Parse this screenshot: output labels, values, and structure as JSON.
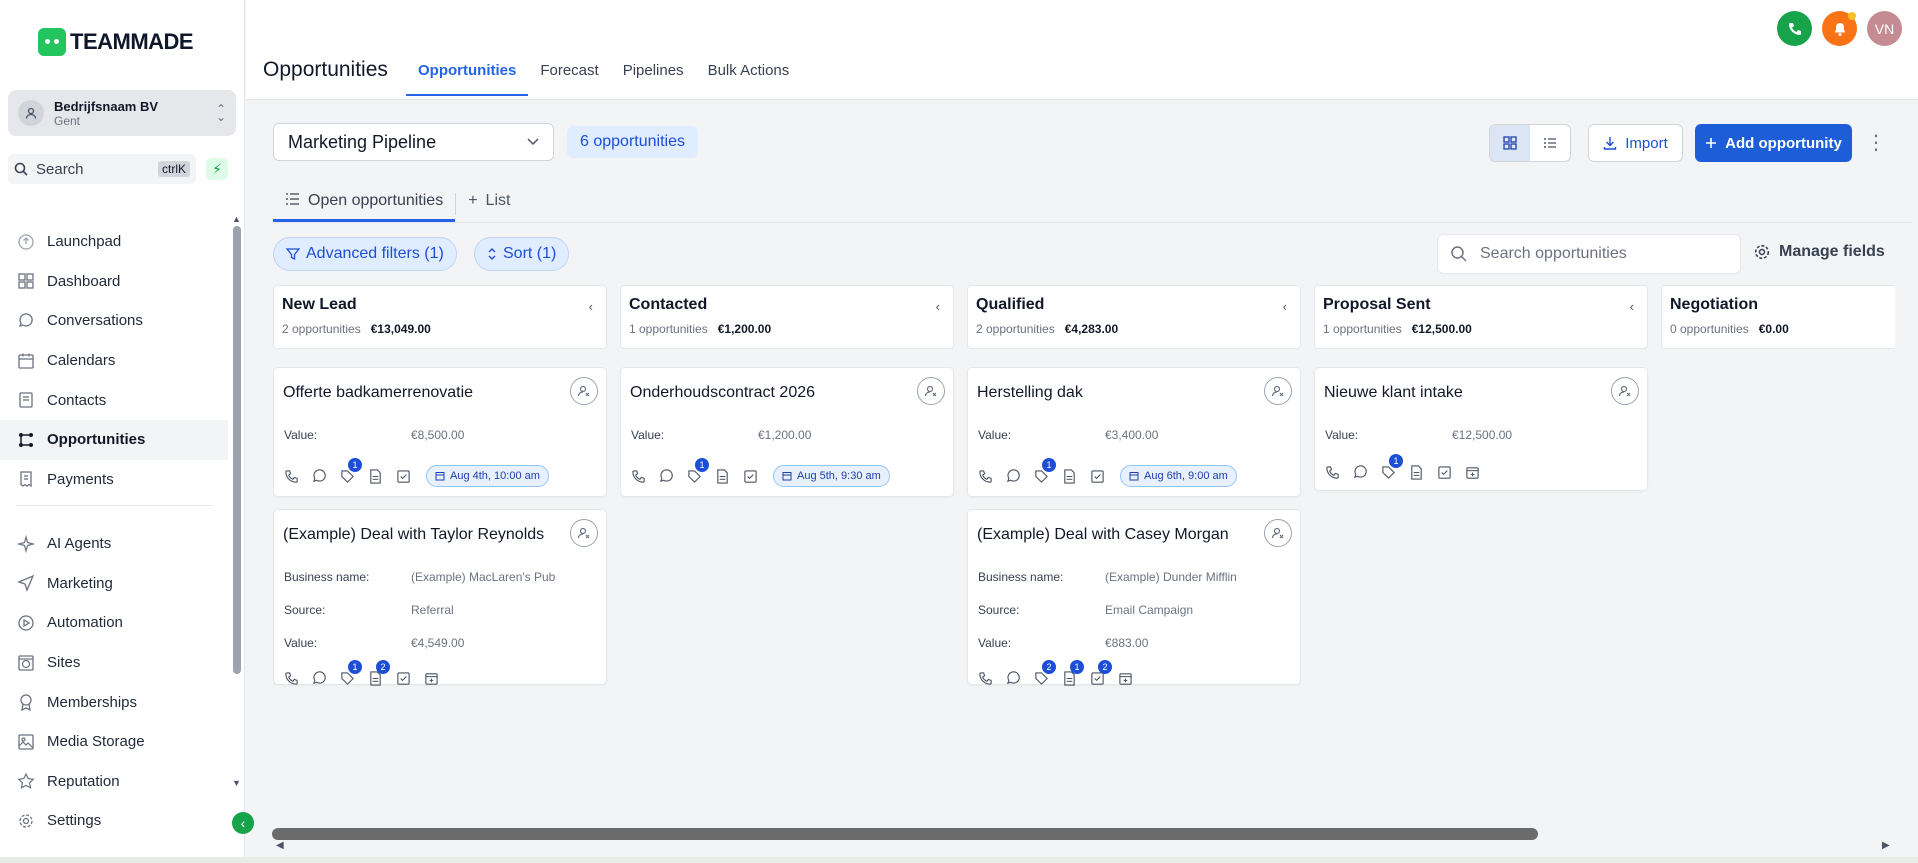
{
  "brand": {
    "logo_text": "TEAMMADE"
  },
  "company": {
    "name": "Bedrijfsnaam BV",
    "location": "Gent"
  },
  "search": {
    "label": "Search",
    "shortcut": "ctrlK"
  },
  "sidebar": {
    "items": [
      {
        "label": "Launchpad",
        "icon": "rocket-icon"
      },
      {
        "label": "Dashboard",
        "icon": "grid-icon"
      },
      {
        "label": "Conversations",
        "icon": "chat-icon"
      },
      {
        "label": "Calendars",
        "icon": "calendar-icon"
      },
      {
        "label": "Contacts",
        "icon": "contacts-icon"
      },
      {
        "label": "Opportunities",
        "icon": "pipeline-icon",
        "active": true
      },
      {
        "label": "Payments",
        "icon": "receipt-icon"
      }
    ],
    "items2": [
      {
        "label": "AI Agents",
        "icon": "sparkle-icon"
      },
      {
        "label": "Marketing",
        "icon": "send-icon"
      },
      {
        "label": "Automation",
        "icon": "automation-icon"
      },
      {
        "label": "Sites",
        "icon": "globe-icon"
      },
      {
        "label": "Memberships",
        "icon": "badge-icon"
      },
      {
        "label": "Media Storage",
        "icon": "image-icon"
      },
      {
        "label": "Reputation",
        "icon": "star-icon"
      },
      {
        "label": "Settings",
        "icon": "gear-icon"
      }
    ]
  },
  "header": {
    "title": "Opportunities",
    "tabs": [
      "Opportunities",
      "Forecast",
      "Pipelines",
      "Bulk Actions"
    ],
    "user_initials": "VN"
  },
  "toolbar": {
    "pipeline": "Marketing Pipeline",
    "count": "6 opportunities",
    "import_label": "Import",
    "add_label": "Add opportunity"
  },
  "subtabs": {
    "open": "Open opportunities",
    "list": "List"
  },
  "filters": {
    "advanced": "Advanced filters (1)",
    "sort": "Sort (1)",
    "search_placeholder": "Search opportunities",
    "manage_fields": "Manage fields"
  },
  "columns": [
    {
      "title": "New Lead",
      "count": "2 opportunities",
      "total": "€13,049.00"
    },
    {
      "title": "Contacted",
      "count": "1 opportunities",
      "total": "€1,200.00"
    },
    {
      "title": "Qualified",
      "count": "2 opportunities",
      "total": "€4,283.00"
    },
    {
      "title": "Proposal Sent",
      "count": "1 opportunities",
      "total": "€12,500.00"
    },
    {
      "title": "Negotiation",
      "count": "0 opportunities",
      "total": "€0.00"
    }
  ],
  "labels": {
    "value": "Value:",
    "business": "Business name:",
    "source": "Source:"
  },
  "cards": {
    "c1": {
      "title": "Offerte badkamerrenovatie",
      "value": "€8,500.00",
      "tag_badge": "1",
      "date": "Aug 4th, 10:00 am"
    },
    "c2": {
      "title": "(Example) Deal with Taylor Reynolds",
      "business": "(Example) MacLaren's Pub",
      "source": "Referral",
      "value": "€4,549.00",
      "tag_badge": "1",
      "doc_badge": "2"
    },
    "c3": {
      "title": "Onderhoudscontract 2026",
      "value": "€1,200.00",
      "tag_badge": "1",
      "date": "Aug 5th, 9:30 am"
    },
    "c4": {
      "title": "Herstelling dak",
      "value": "€3,400.00",
      "tag_badge": "1",
      "date": "Aug 6th, 9:00 am"
    },
    "c5": {
      "title": "(Example) Deal with Casey Morgan",
      "business": "(Example) Dunder Mifflin",
      "source": "Email Campaign",
      "value": "€883.00",
      "tag_badge": "2",
      "doc_badge": "1",
      "task_badge": "2"
    },
    "c6": {
      "title": "Nieuwe klant intake",
      "value": "€12,500.00",
      "tag_badge": "1"
    }
  }
}
